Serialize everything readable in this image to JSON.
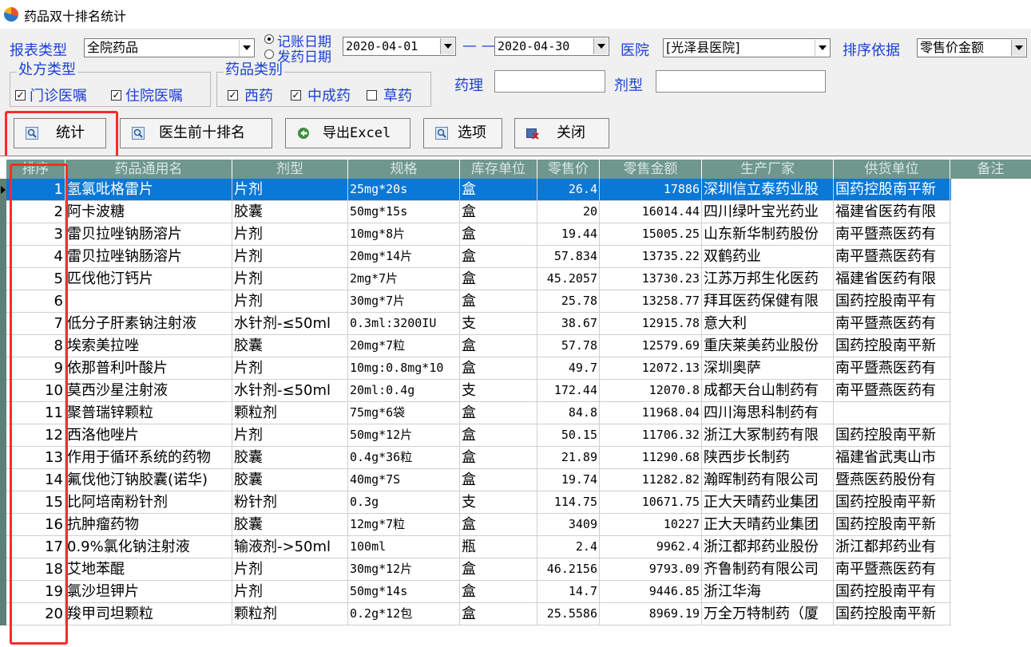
{
  "window": {
    "title": "药品双十排名统计"
  },
  "filters": {
    "report_type_label": "报表类型",
    "report_type_value": "全院药品",
    "date_mode_options": [
      "记账日期",
      "发药日期"
    ],
    "date_from": "2020-04-01",
    "date_separator": "— —",
    "date_to": "2020-04-30",
    "hospital_label": "医院",
    "hospital_value": "[光泽县医院]",
    "sort_label": "排序依据",
    "sort_value": "零售价金额",
    "prescription_group_title": "处方类型",
    "prescription_types": [
      {
        "label": "门诊医嘱",
        "checked": true
      },
      {
        "label": "住院医嘱",
        "checked": true
      }
    ],
    "drug_category_group_title": "药品类别",
    "drug_categories": [
      {
        "label": "西药",
        "checked": true
      },
      {
        "label": "中成药",
        "checked": true
      },
      {
        "label": "草药",
        "checked": false
      }
    ],
    "pharmacology_label": "药理",
    "dosage_form_label": "剂型",
    "check_mark": "✓"
  },
  "toolbar": {
    "stats": "统计",
    "top_ten_doctors": "医生前十排名",
    "export_excel": "导出Excel",
    "options": "选项",
    "close": "关闭"
  },
  "table": {
    "columns": [
      "排序",
      "药品通用名",
      "剂型",
      "规格",
      "库存单位",
      "零售价",
      "零售金额",
      "生产厂家",
      "供货单位",
      "备注"
    ],
    "rows": [
      [
        "1",
        "氢氯吡格雷片",
        "片剂",
        "25mg*20s",
        "盒",
        "26.4",
        "17886",
        "深圳信立泰药业股",
        "国药控股南平新",
        ""
      ],
      [
        "2",
        "阿卡波糖",
        "胶囊",
        "50mg*15s",
        "盒",
        "20",
        "16014.44",
        "四川绿叶宝光药业",
        "福建省医药有限",
        ""
      ],
      [
        "3",
        "雷贝拉唑钠肠溶片",
        "片剂",
        "10mg*8片",
        "盒",
        "19.44",
        "15005.25",
        "山东新华制药股份",
        "南平暨燕医药有",
        ""
      ],
      [
        "4",
        "雷贝拉唑钠肠溶片",
        "片剂",
        "20mg*14片",
        "盒",
        "57.834",
        "13735.22",
        "双鹤药业",
        "南平暨燕医药有",
        ""
      ],
      [
        "5",
        "匹伐他汀钙片",
        "片剂",
        "2mg*7片",
        "盒",
        "45.2057",
        "13730.23",
        "江苏万邦生化医药",
        "福建省医药有限",
        ""
      ],
      [
        "6",
        "",
        "片剂",
        "30mg*7片",
        "盒",
        "25.78",
        "13258.77",
        "拜耳医药保健有限",
        "国药控股南平有",
        ""
      ],
      [
        "7",
        "低分子肝素钠注射液",
        "水针剂-≤50ml",
        "0.3ml:3200IU",
        "支",
        "38.67",
        "12915.78",
        "意大利",
        "南平暨燕医药有",
        ""
      ],
      [
        "8",
        "埃索美拉唑",
        "胶囊",
        "20mg*7粒",
        "盒",
        "57.78",
        "12579.69",
        "重庆莱美药业股份",
        "国药控股南平新",
        ""
      ],
      [
        "9",
        "依那普利叶酸片",
        "片剂",
        "10mg:0.8mg*10",
        "盒",
        "49.7",
        "12072.13",
        "深圳奥萨",
        "南平暨燕医药有",
        ""
      ],
      [
        "10",
        "莫西沙星注射液",
        "水针剂-≤50ml",
        "20ml:0.4g",
        "支",
        "172.44",
        "12070.8",
        "成都天台山制药有",
        "南平暨燕医药有",
        ""
      ],
      [
        "11",
        "聚普瑞锌颗粒",
        "颗粒剂",
        "75mg*6袋",
        "盒",
        "84.8",
        "11968.04",
        "四川海思科制药有",
        "",
        ""
      ],
      [
        "12",
        "西洛他唑片",
        "片剂",
        "50mg*12片",
        "盒",
        "50.15",
        "11706.32",
        "浙江大冢制药有限",
        "国药控股南平新",
        ""
      ],
      [
        "13",
        "作用于循环系统的药物",
        "胶囊",
        "0.4g*36粒",
        "盒",
        "21.89",
        "11290.68",
        "陕西步长制药",
        "福建省武夷山市",
        ""
      ],
      [
        "14",
        "氟伐他汀钠胶囊(诺华)",
        "胶囊",
        "40mg*7S",
        "盒",
        "19.74",
        "11282.82",
        "瀚晖制药有限公司",
        "暨燕医药股份有",
        ""
      ],
      [
        "15",
        "比阿培南粉针剂",
        "粉针剂",
        "0.3g",
        "支",
        "114.75",
        "10671.75",
        "正大天晴药业集团",
        "国药控股南平新",
        ""
      ],
      [
        "16",
        "抗肿瘤药物",
        "胶囊",
        "12mg*7粒",
        "盒",
        "3409",
        "10227",
        "正大天晴药业集团",
        "国药控股南平新",
        ""
      ],
      [
        "17",
        "0.9%氯化钠注射液",
        "输液剂->50ml",
        "100ml",
        "瓶",
        "2.4",
        "9962.4",
        "浙江都邦药业股份",
        "浙江都邦药业有",
        ""
      ],
      [
        "18",
        "艾地苯醌",
        "片剂",
        "30mg*12片",
        "盒",
        "46.2156",
        "9793.09",
        "齐鲁制药有限公司",
        "南平暨燕医药有",
        ""
      ],
      [
        "19",
        "氯沙坦钾片",
        "片剂",
        "50mg*14s",
        "盒",
        "14.7",
        "9446.85",
        "浙江华海",
        "国药控股南平有",
        ""
      ],
      [
        "20",
        "羧甲司坦颗粒",
        "颗粒剂",
        "0.2g*12包",
        "盒",
        "25.5586",
        "8969.19",
        "万全万特制药（厦",
        "国药控股南平新",
        ""
      ]
    ]
  }
}
